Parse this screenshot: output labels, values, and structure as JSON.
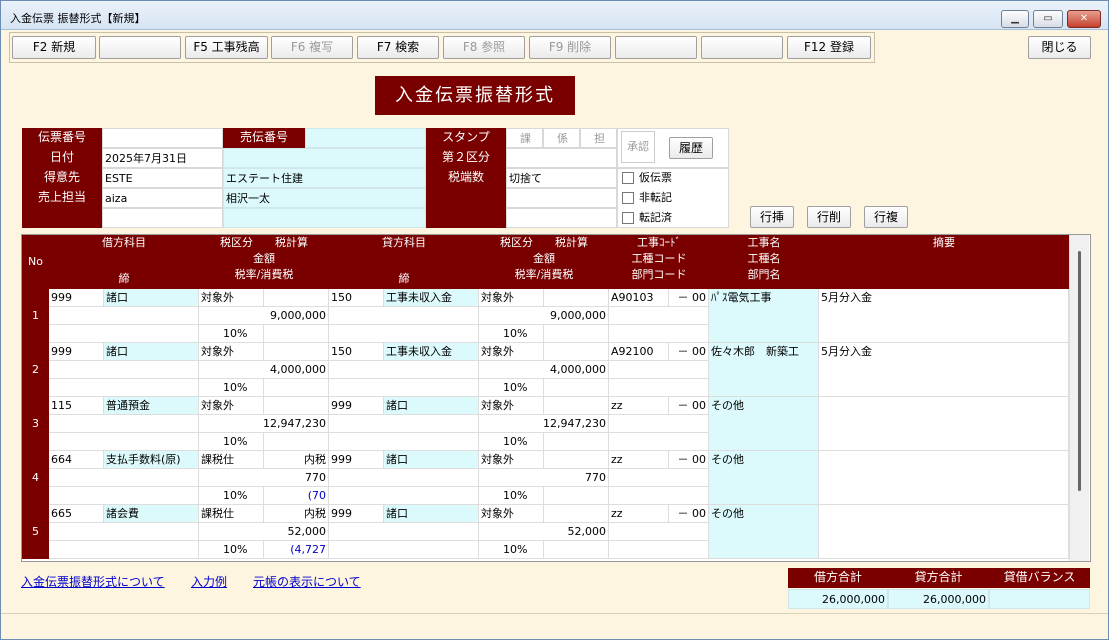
{
  "window": {
    "title": "入金伝票 振替形式【新規】",
    "min": "▁",
    "max": "▭",
    "close": "✕"
  },
  "toolbar": [
    {
      "label": "F2 新規",
      "enabled": true
    },
    {
      "label": "",
      "enabled": false
    },
    {
      "label": "F5 工事残高",
      "enabled": true
    },
    {
      "label": "F6 複写",
      "enabled": false
    },
    {
      "label": "F7 検索",
      "enabled": true
    },
    {
      "label": "F8 参照",
      "enabled": false
    },
    {
      "label": "F9 削除",
      "enabled": false
    },
    {
      "label": "",
      "enabled": false
    },
    {
      "label": "",
      "enabled": false
    },
    {
      "label": "F12 登録",
      "enabled": true
    }
  ],
  "close_label": "閉じる",
  "heading": "入金伝票振替形式",
  "header": {
    "denpyo_label": "伝票番号",
    "denpyo": "",
    "uriden_label": "売伝番号",
    "uriden": "",
    "date_label": "日付",
    "date": "2025年7月31日",
    "tokui_label": "得意先",
    "tokui_code": "ESTE",
    "tokui_name": "エステート住建",
    "tanto_label": "売上担当",
    "tanto_code": "aiza",
    "tanto_name": "相沢一太",
    "stamp_label": "スタンプ",
    "stamp1": "課",
    "stamp2": "係",
    "stamp3": "担",
    "kubun2_label": "第２区分",
    "kubun2": "",
    "hasu_label": "税端数",
    "hasu": "切捨て",
    "approve": "承認",
    "history": "履歴",
    "chk1": "仮伝票",
    "chk2": "非転記",
    "chk3": "転記済",
    "row_ins": "行挿",
    "row_del": "行削",
    "row_dup": "行複"
  },
  "grid_head": {
    "no": "No",
    "debit": "借方科目",
    "debit_sub": "締",
    "tax": "税区分",
    "taxcalc": "税計算",
    "amount": "金額",
    "rate": "税率/消費税",
    "credit": "貸方科目",
    "credit_sub": "締",
    "tax2": "税区分",
    "taxcalc2": "税計算",
    "amount2": "金額",
    "rate2": "税率/消費税",
    "kcode": "工事ｺｰﾄﾞ",
    "ktype": "工種コード",
    "bcode": "部門コード",
    "kname": "工事名",
    "ktypename": "工種名",
    "bname": "部門名",
    "memo": "摘要"
  },
  "rows": [
    {
      "no": "1",
      "dcode": "999",
      "dname": "諸口",
      "dtax": "対象外",
      "dcalc": "",
      "damt": "9,000,000",
      "drate": "10%",
      "dtaxamt": "",
      "ccode": "150",
      "cname": "工事未収入金",
      "ctax": "対象外",
      "ccalc": "",
      "camt": "9,000,000",
      "crate": "10%",
      "kcode": "A90103",
      "kdash": "－ 00",
      "kname": "ﾊﾟｽ電気工事",
      "memo": "5月分入金"
    },
    {
      "no": "2",
      "dcode": "999",
      "dname": "諸口",
      "dtax": "対象外",
      "dcalc": "",
      "damt": "4,000,000",
      "drate": "10%",
      "dtaxamt": "",
      "ccode": "150",
      "cname": "工事未収入金",
      "ctax": "対象外",
      "ccalc": "",
      "camt": "4,000,000",
      "crate": "10%",
      "kcode": "A92100",
      "kdash": "－ 00",
      "kname": "佐々木郎　新築工",
      "memo": "5月分入金"
    },
    {
      "no": "3",
      "dcode": "115",
      "dname": "普通預金",
      "dtax": "対象外",
      "dcalc": "",
      "damt": "12,947,230",
      "drate": "10%",
      "dtaxamt": "",
      "ccode": "999",
      "cname": "諸口",
      "ctax": "対象外",
      "ccalc": "",
      "camt": "12,947,230",
      "crate": "10%",
      "kcode": "zz",
      "kdash": "－ 00",
      "kname": "その他",
      "memo": ""
    },
    {
      "no": "4",
      "dcode": "664",
      "dname": "支払手数料(原)",
      "dtax": "課税仕",
      "dcalc": "内税",
      "damt": "770",
      "drate": "10%",
      "dtaxamt": "(70",
      "ccode": "999",
      "cname": "諸口",
      "ctax": "対象外",
      "ccalc": "",
      "camt": "770",
      "crate": "10%",
      "kcode": "zz",
      "kdash": "－ 00",
      "kname": "その他",
      "memo": ""
    },
    {
      "no": "5",
      "dcode": "665",
      "dname": "諸会費",
      "dtax": "課税仕",
      "dcalc": "内税",
      "damt": "52,000",
      "drate": "10%",
      "dtaxamt": "(4,727",
      "ccode": "999",
      "cname": "諸口",
      "ctax": "対象外",
      "ccalc": "",
      "camt": "52,000",
      "crate": "10%",
      "kcode": "zz",
      "kdash": "－ 00",
      "kname": "その他",
      "memo": ""
    }
  ],
  "links": [
    "入金伝票振替形式について",
    "入力例",
    "元帳の表示について"
  ],
  "totals": {
    "debit_label": "借方合計",
    "credit_label": "貸方合計",
    "balance_label": "貸借バランス",
    "debit": "26,000,000",
    "credit": "26,000,000",
    "balance": ""
  }
}
